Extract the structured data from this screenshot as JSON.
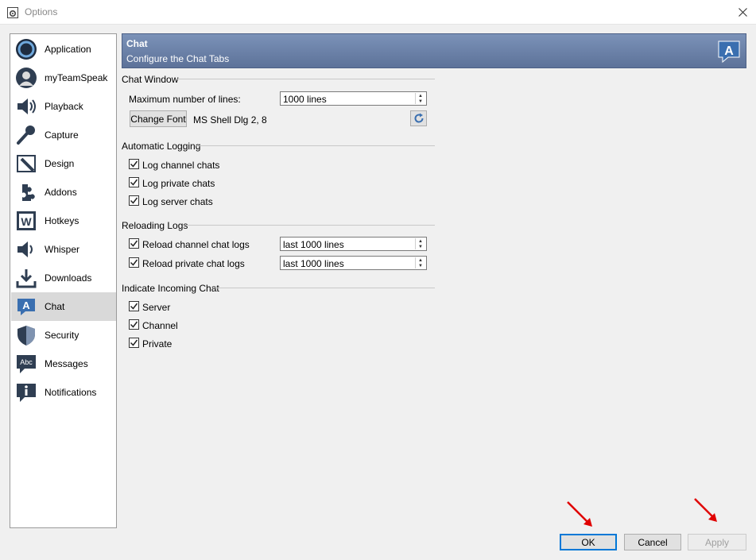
{
  "window": {
    "title": "Options"
  },
  "sidebar": {
    "items": [
      {
        "label": "Application",
        "icon": "application-icon"
      },
      {
        "label": "myTeamSpeak",
        "icon": "user-icon"
      },
      {
        "label": "Playback",
        "icon": "speaker-icon"
      },
      {
        "label": "Capture",
        "icon": "microphone-icon"
      },
      {
        "label": "Design",
        "icon": "design-icon"
      },
      {
        "label": "Addons",
        "icon": "puzzle-icon"
      },
      {
        "label": "Hotkeys",
        "icon": "hotkeys-icon"
      },
      {
        "label": "Whisper",
        "icon": "whisper-icon"
      },
      {
        "label": "Downloads",
        "icon": "download-icon"
      },
      {
        "label": "Chat",
        "icon": "chat-icon",
        "selected": true
      },
      {
        "label": "Security",
        "icon": "shield-icon"
      },
      {
        "label": "Messages",
        "icon": "messages-icon"
      },
      {
        "label": "Notifications",
        "icon": "info-icon"
      }
    ]
  },
  "banner": {
    "title": "Chat",
    "subtitle": "Configure the Chat Tabs"
  },
  "chat_window": {
    "title": "Chat Window",
    "max_lines_label": "Maximum number of lines:",
    "max_lines_value": "1000 lines",
    "change_font_label": "Change Font",
    "font_value": "MS Shell Dlg 2, 8"
  },
  "auto_logging": {
    "title": "Automatic Logging",
    "items": [
      {
        "label": "Log channel chats",
        "checked": true
      },
      {
        "label": "Log private chats",
        "checked": true
      },
      {
        "label": "Log server chats",
        "checked": true
      }
    ]
  },
  "reloading_logs": {
    "title": "Reloading Logs",
    "items": [
      {
        "label": "Reload channel chat logs",
        "checked": true,
        "value": "last 1000 lines"
      },
      {
        "label": "Reload private chat logs",
        "checked": true,
        "value": "last 1000 lines"
      }
    ]
  },
  "incoming_chat": {
    "title": "Indicate Incoming Chat",
    "items": [
      {
        "label": "Server",
        "checked": true
      },
      {
        "label": "Channel",
        "checked": true
      },
      {
        "label": "Private",
        "checked": true
      }
    ]
  },
  "footer": {
    "ok_label": "OK",
    "cancel_label": "Cancel",
    "apply_label": "Apply"
  },
  "colors": {
    "banner": "#6d82a9",
    "selected": "#d9d9d9",
    "accent": "#0078d7",
    "annotation": "#e00000"
  }
}
